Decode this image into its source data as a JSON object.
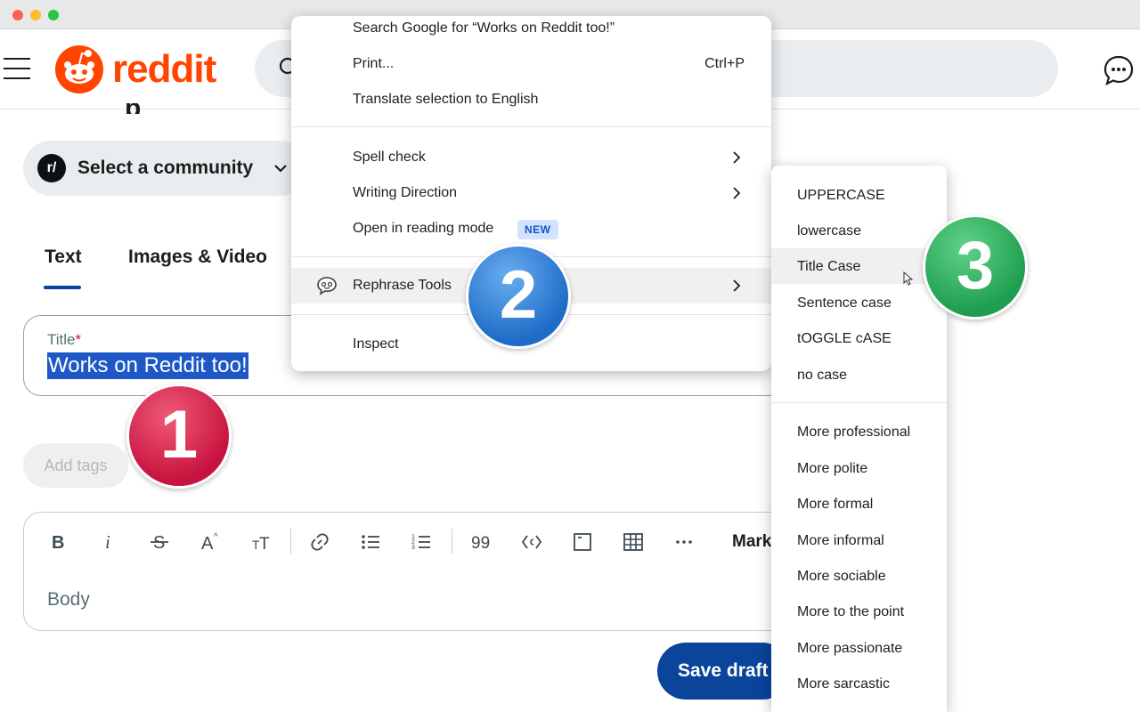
{
  "header": {
    "brand": "reddit"
  },
  "page": {
    "community_selector": "Select a community",
    "community_badge": "r/",
    "tabs": [
      {
        "label": "Text",
        "active": true
      },
      {
        "label": "Images & Video",
        "active": false
      }
    ],
    "title_field": {
      "label": "Title",
      "required_mark": "*",
      "value": "Works on Reddit too!"
    },
    "add_tags": "Add tags",
    "editor": {
      "markdown_label": "Mark",
      "body_placeholder": "Body",
      "toolbar_icons": [
        "bold-icon",
        "italic-icon",
        "strikethrough-icon",
        "superscript-icon",
        "heading-icon",
        "link-icon",
        "bullet-list-icon",
        "numbered-list-icon",
        "quote-icon",
        "code-icon",
        "code-block-icon",
        "table-icon",
        "more-icon"
      ]
    },
    "save_draft": "Save draft"
  },
  "context_menu": {
    "search_google": "Search Google for “Works on Reddit too!”",
    "print": "Print...",
    "print_shortcut": "Ctrl+P",
    "translate": "Translate selection to English",
    "spell_check": "Spell check",
    "writing_direction": "Writing Direction",
    "reading_mode": "Open in reading mode",
    "reading_mode_badge": "NEW",
    "rephrase_tools": "Rephrase Tools",
    "inspect": "Inspect"
  },
  "submenu": {
    "case_items": [
      "UPPERCASE",
      "lowercase",
      "Title Case",
      "Sentence case",
      "tOGGLE cASE",
      "no case"
    ],
    "tone_items": [
      "More professional",
      "More polite",
      "More formal",
      "More informal",
      "More sociable",
      "More to the point",
      "More passionate",
      "More sarcastic"
    ],
    "highlighted": "Title Case"
  },
  "steps": [
    "1",
    "2",
    "3"
  ],
  "colors": {
    "brand": "#ff4500",
    "primary_button": "#0a449b",
    "selection": "#1e58c7",
    "step1": "#d3214a",
    "step2": "#2f80d6",
    "step3": "#25ad5a"
  }
}
